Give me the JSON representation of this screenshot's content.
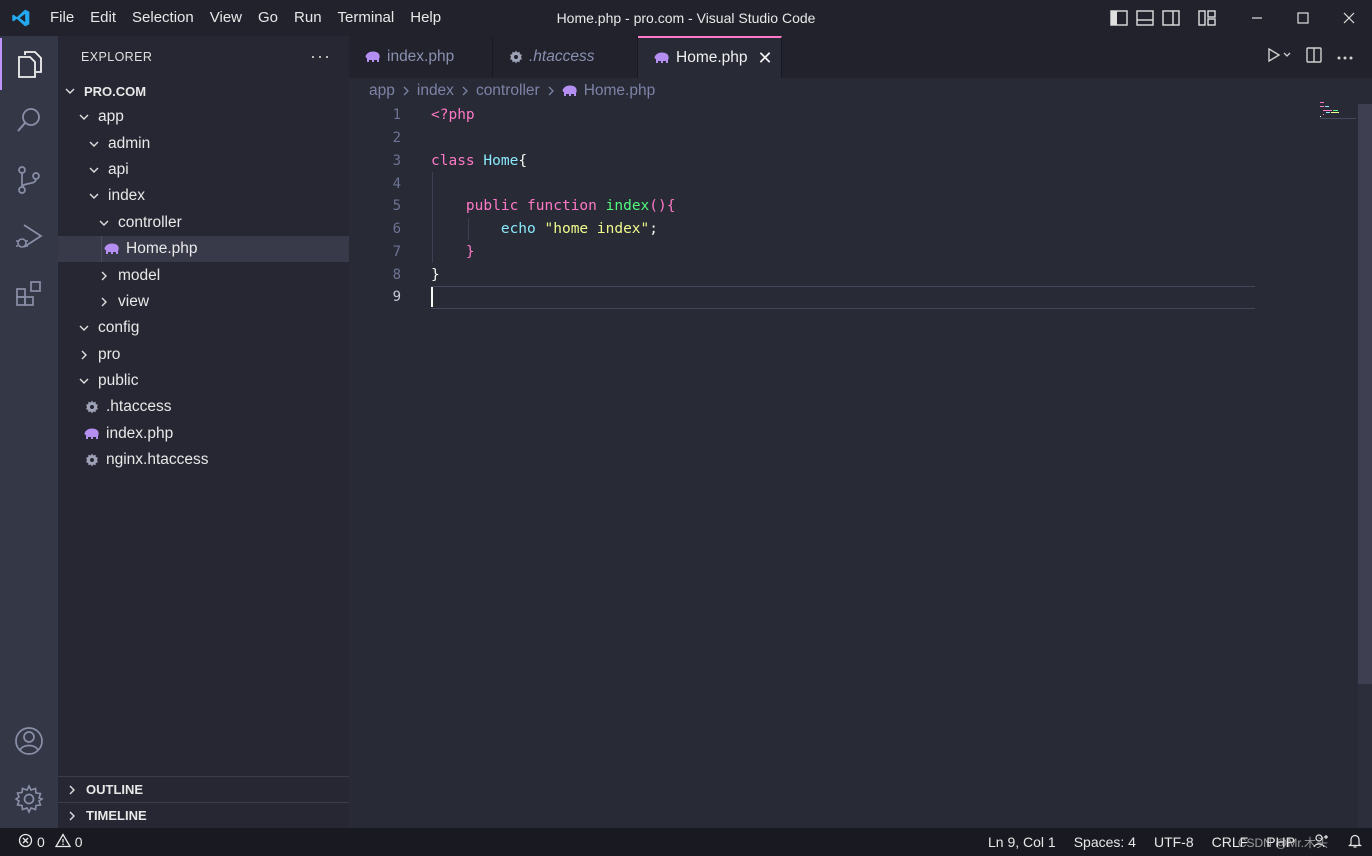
{
  "titlebar": {
    "menu": [
      "File",
      "Edit",
      "Selection",
      "View",
      "Go",
      "Run",
      "Terminal",
      "Help"
    ],
    "window_title": "Home.php - pro.com - Visual Studio Code"
  },
  "sidebar": {
    "header": "EXPLORER",
    "more": "···",
    "root": "PRO.COM",
    "tree": {
      "app": "app",
      "admin": "admin",
      "api": "api",
      "index": "index",
      "controller": "controller",
      "home_php": "Home.php",
      "model": "model",
      "view": "view",
      "config": "config",
      "pro": "pro",
      "public": "public",
      "htaccess": ".htaccess",
      "index_php": "index.php",
      "nginx_htaccess": "nginx.htaccess"
    },
    "outline": "OUTLINE",
    "timeline": "TIMELINE"
  },
  "tabs": [
    {
      "label": "index.php"
    },
    {
      "label": ".htaccess"
    },
    {
      "label": "Home.php"
    }
  ],
  "tab_close": "✕",
  "breadcrumb": [
    "app",
    "index",
    "controller",
    "Home.php"
  ],
  "code": {
    "line_numbers": [
      "1",
      "2",
      "3",
      "4",
      "5",
      "6",
      "7",
      "8",
      "9"
    ],
    "l1_open": "<?php",
    "l3_class": "class",
    "l3_name": "Home",
    "l3_brace": "{",
    "l5_public": "public",
    "l5_function": "function",
    "l5_name": "index",
    "l5_paren": "(){",
    "l6_echo": "echo",
    "l6_string": "\"home index\"",
    "l6_semi": ";",
    "l7_close": "}",
    "l8_close": "}"
  },
  "statusbar": {
    "errors": "0",
    "warnings": "0",
    "position": "Ln 9, Col 1",
    "spaces": "Spaces: 4",
    "encoding": "UTF-8",
    "eol": "CRLF",
    "language": "PHP",
    "watermark": "CSDN @Mr.木头"
  },
  "colors": {
    "accent": "#bd93f9",
    "tab_active_border": "#ff79c6",
    "keyword": "#ff79c6",
    "class_name": "#8be9fd",
    "function_name": "#50fa7b",
    "string": "#f1fa8c"
  },
  "icons": {
    "app": "vscode-logo-icon",
    "explorer": "files-icon",
    "search": "search-icon",
    "scm": "source-control-icon",
    "debug": "run-debug-icon",
    "extensions": "extensions-icon",
    "account": "account-icon",
    "settings": "gear-icon",
    "php_file": "php-elephant-icon",
    "config_file": "gear-icon"
  }
}
